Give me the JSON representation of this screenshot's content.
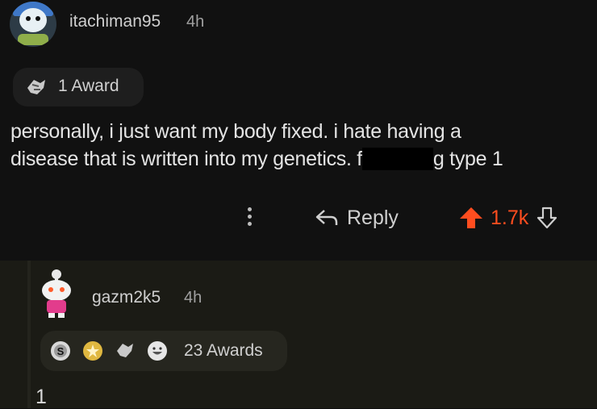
{
  "comment": {
    "username": "itachiman95",
    "time": "4h",
    "awards_label": "1 Award",
    "body_line1": "personally, i just want my body fixed. i hate having a",
    "body_line2_start": "disease that is written into my genetics. f",
    "body_line2_end": "g type 1",
    "reply_label": "Reply",
    "score": "1.7k"
  },
  "reply": {
    "username": "gazm2k5",
    "time": "4h",
    "awards_label": "23 Awards",
    "body_start": "1"
  },
  "colors": {
    "upvote": "#ff4d1f",
    "background": "#0f0f0f",
    "reply_bg": "#1b1b15"
  }
}
